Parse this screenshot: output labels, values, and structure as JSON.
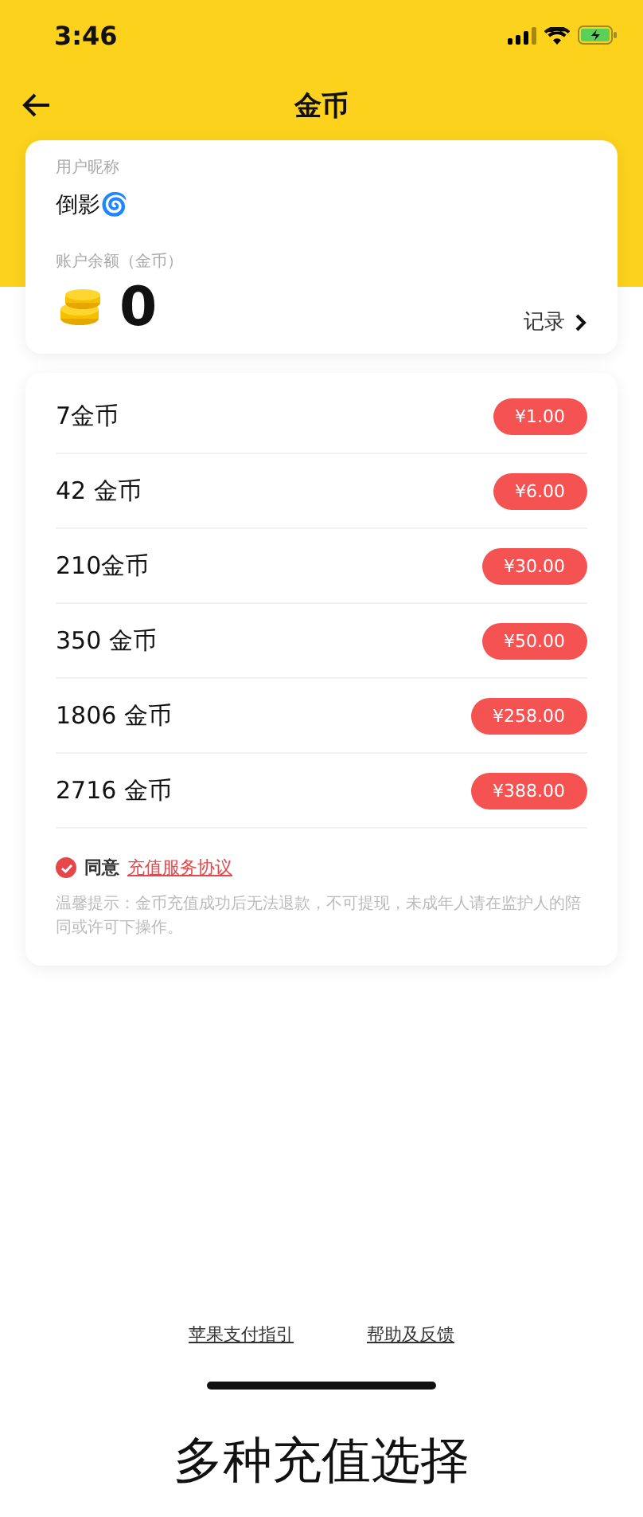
{
  "status_bar": {
    "time": "3:46"
  },
  "nav": {
    "title": "金币"
  },
  "account": {
    "nickname_label": "用户昵称",
    "nickname": "倒影🌀",
    "balance_label": "账户余额（金币）",
    "balance": "0",
    "records_link": "记录"
  },
  "packages": [
    {
      "coins": "7金币",
      "price": "¥1.00"
    },
    {
      "coins": "42 金币",
      "price": "¥6.00"
    },
    {
      "coins": "210金币",
      "price": "¥30.00"
    },
    {
      "coins": "350 金币",
      "price": "¥50.00"
    },
    {
      "coins": "1806 金币",
      "price": "¥258.00"
    },
    {
      "coins": "2716 金币",
      "price": "¥388.00"
    }
  ],
  "agreement": {
    "checked": true,
    "label": "同意",
    "link": "充值服务协议"
  },
  "notice": "温馨提示：金币充值成功后无法退款，不可提现，未成年人请在监护人的陪同或许可下操作。",
  "footer_links": [
    "苹果支付指引",
    "帮助及反馈"
  ],
  "caption": "多种充值选择"
}
